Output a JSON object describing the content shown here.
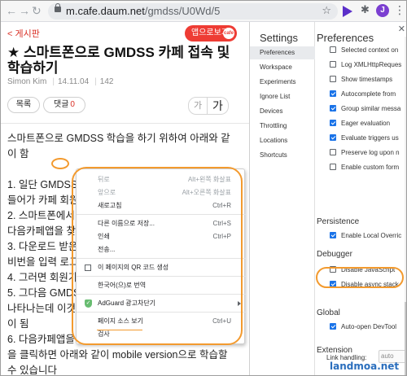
{
  "browser": {
    "url_host": "m.cafe.daum.net",
    "url_path": "/gmdss/U0Wd/5",
    "avatar_letter": "J",
    "back_icon": "back-arrow-icon",
    "forward_icon": "forward-arrow-icon",
    "reload_icon": "reload-icon"
  },
  "page": {
    "back_label": "< 게시판",
    "app_button": "앱으로보기",
    "app_button_badge": "cafe",
    "title": "★ 스마트폰으로 GMDSS 카페 접속 및 학습하기",
    "author": "Simon Kim",
    "date": "14.11.04",
    "views": "142",
    "list_button": "목록",
    "comment_button": "댓글",
    "comment_count": "0",
    "font_small": "가",
    "font_big": "가",
    "body_lines": [
      "스마트폰으로 GMDSS 학습을 하기 위하여 아래와 같",
      "이 함",
      "",
      "1. 일단 GMDSS",
      "들어가 카페 회원",
      "2. 스마트폰에서",
      "다음카페앱을 찾",
      "3. 다운로드 받은",
      "비번을 입력 로그",
      "4. 그러면 회원가",
      "5. 그다음 GMDS",
      "나타나는데 이것",
      "이 됨",
      "6. 다음카페앱을",
      "을 클릭하면 아래와 같이 mobile version으로 학습할",
      "수 있습니다"
    ]
  },
  "context_menu": {
    "items": [
      {
        "label": "뒤로",
        "shortcut": "Alt+왼쪽 화살표",
        "disabled": true
      },
      {
        "label": "앞으로",
        "shortcut": "Alt+오른쪽 화살표",
        "disabled": true
      },
      {
        "label": "새로고침",
        "shortcut": "Ctrl+R",
        "disabled": false
      },
      {
        "label": "다른 이름으로 저장...",
        "shortcut": "Ctrl+S",
        "disabled": false
      },
      {
        "label": "인쇄",
        "shortcut": "Ctrl+P",
        "disabled": false
      },
      {
        "label": "전송...",
        "shortcut": "",
        "disabled": false
      },
      {
        "label": "이 페이지의 QR 코드 생성",
        "shortcut": "",
        "disabled": false
      },
      {
        "label": "한국어(으)로 번역",
        "shortcut": "",
        "disabled": false
      },
      {
        "label": "AdGuard 광고차단기",
        "shortcut": "",
        "disabled": false
      },
      {
        "label": "페이지 소스 보기",
        "shortcut": "Ctrl+U",
        "disabled": false
      },
      {
        "label": "검사",
        "shortcut": "",
        "disabled": false
      }
    ]
  },
  "devtools": {
    "settings_title": "Settings",
    "preferences_title": "Preferences",
    "close_glyph": "✕",
    "tabs": [
      "Preferences",
      "Workspace",
      "Experiments",
      "Ignore List",
      "Devices",
      "Throttling",
      "Locations",
      "Shortcuts"
    ],
    "console_options": [
      {
        "label": "Selected context on",
        "checked": false
      },
      {
        "label": "Log XMLHttpReques",
        "checked": false
      },
      {
        "label": "Show timestamps",
        "checked": false
      },
      {
        "label": "Autocomplete from",
        "checked": true
      },
      {
        "label": "Group similar messa",
        "checked": true
      },
      {
        "label": "Eager evaluation",
        "checked": true
      },
      {
        "label": "Evaluate triggers us",
        "checked": true
      },
      {
        "label": "Preserve log upon n",
        "checked": false
      },
      {
        "label": "Enable custom form",
        "checked": false
      }
    ],
    "persistence_title": "Persistence",
    "persistence_options": [
      {
        "label": "Enable Local Overric",
        "checked": true
      }
    ],
    "debugger_title": "Debugger",
    "debugger_options": [
      {
        "label": "Disable JavaScript",
        "checked": false
      },
      {
        "label": "Disable async stack",
        "checked": true
      }
    ],
    "global_title": "Global",
    "global_options": [
      {
        "label": "Auto-open DevTool",
        "checked": true
      }
    ],
    "extension_title": "Extension",
    "link_handling_label": "Link handling:",
    "link_handling_value": "auto"
  },
  "watermark": "landmoa.net",
  "colors": {
    "accent": "#1a73e8",
    "annotation": "#f39a2e",
    "cafe_red": "#ee3c34"
  }
}
